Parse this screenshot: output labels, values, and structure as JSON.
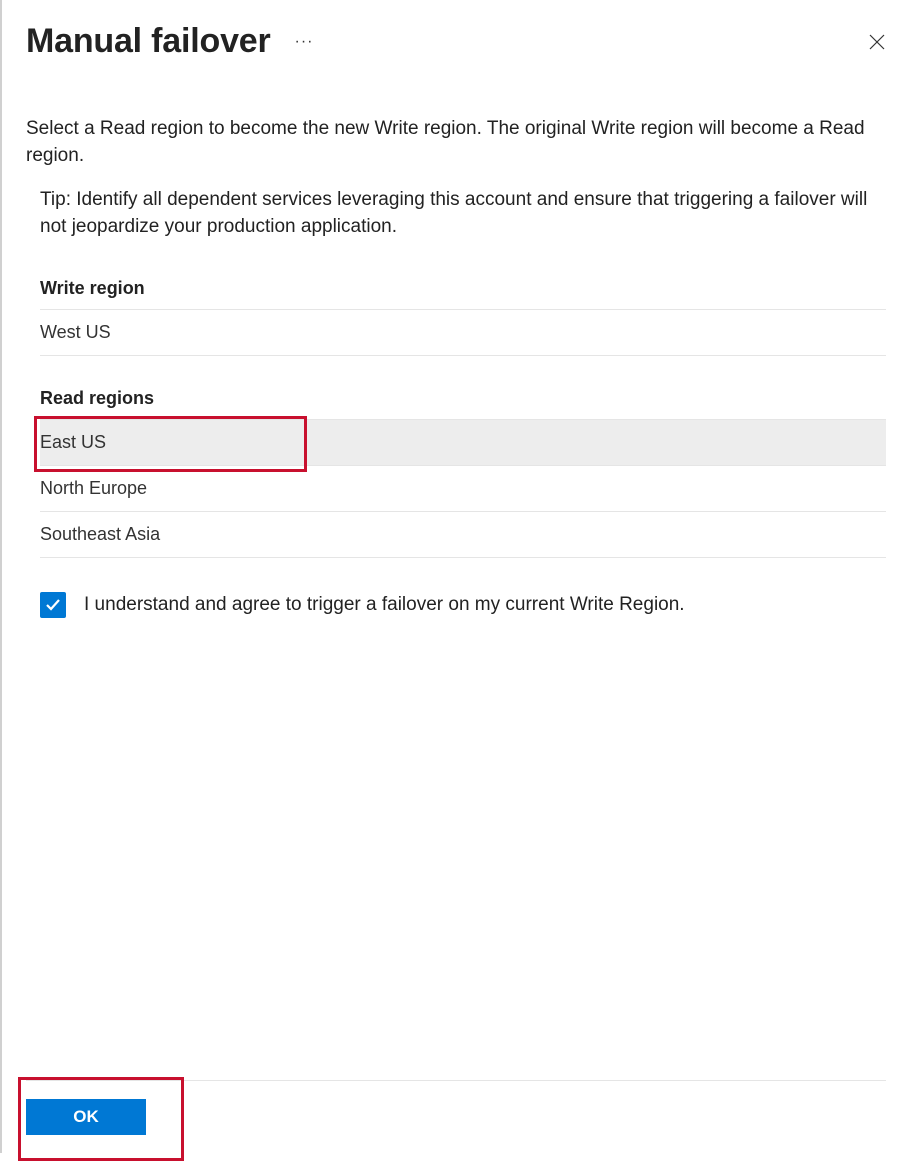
{
  "header": {
    "title": "Manual failover"
  },
  "description": "Select a Read region to become the new Write region. The original Write region will become a Read region.",
  "tip": "Tip: Identify all dependent services leveraging this account and ensure that triggering a failover will not jeopardize your production application.",
  "writeRegion": {
    "label": "Write region",
    "value": "West US"
  },
  "readRegions": {
    "label": "Read regions",
    "items": [
      {
        "name": "East US",
        "selected": true
      },
      {
        "name": "North Europe",
        "selected": false
      },
      {
        "name": "Southeast Asia",
        "selected": false
      }
    ]
  },
  "consent": {
    "checked": true,
    "label": "I understand and agree to trigger a failover on my current Write Region."
  },
  "footer": {
    "ok": "OK"
  }
}
